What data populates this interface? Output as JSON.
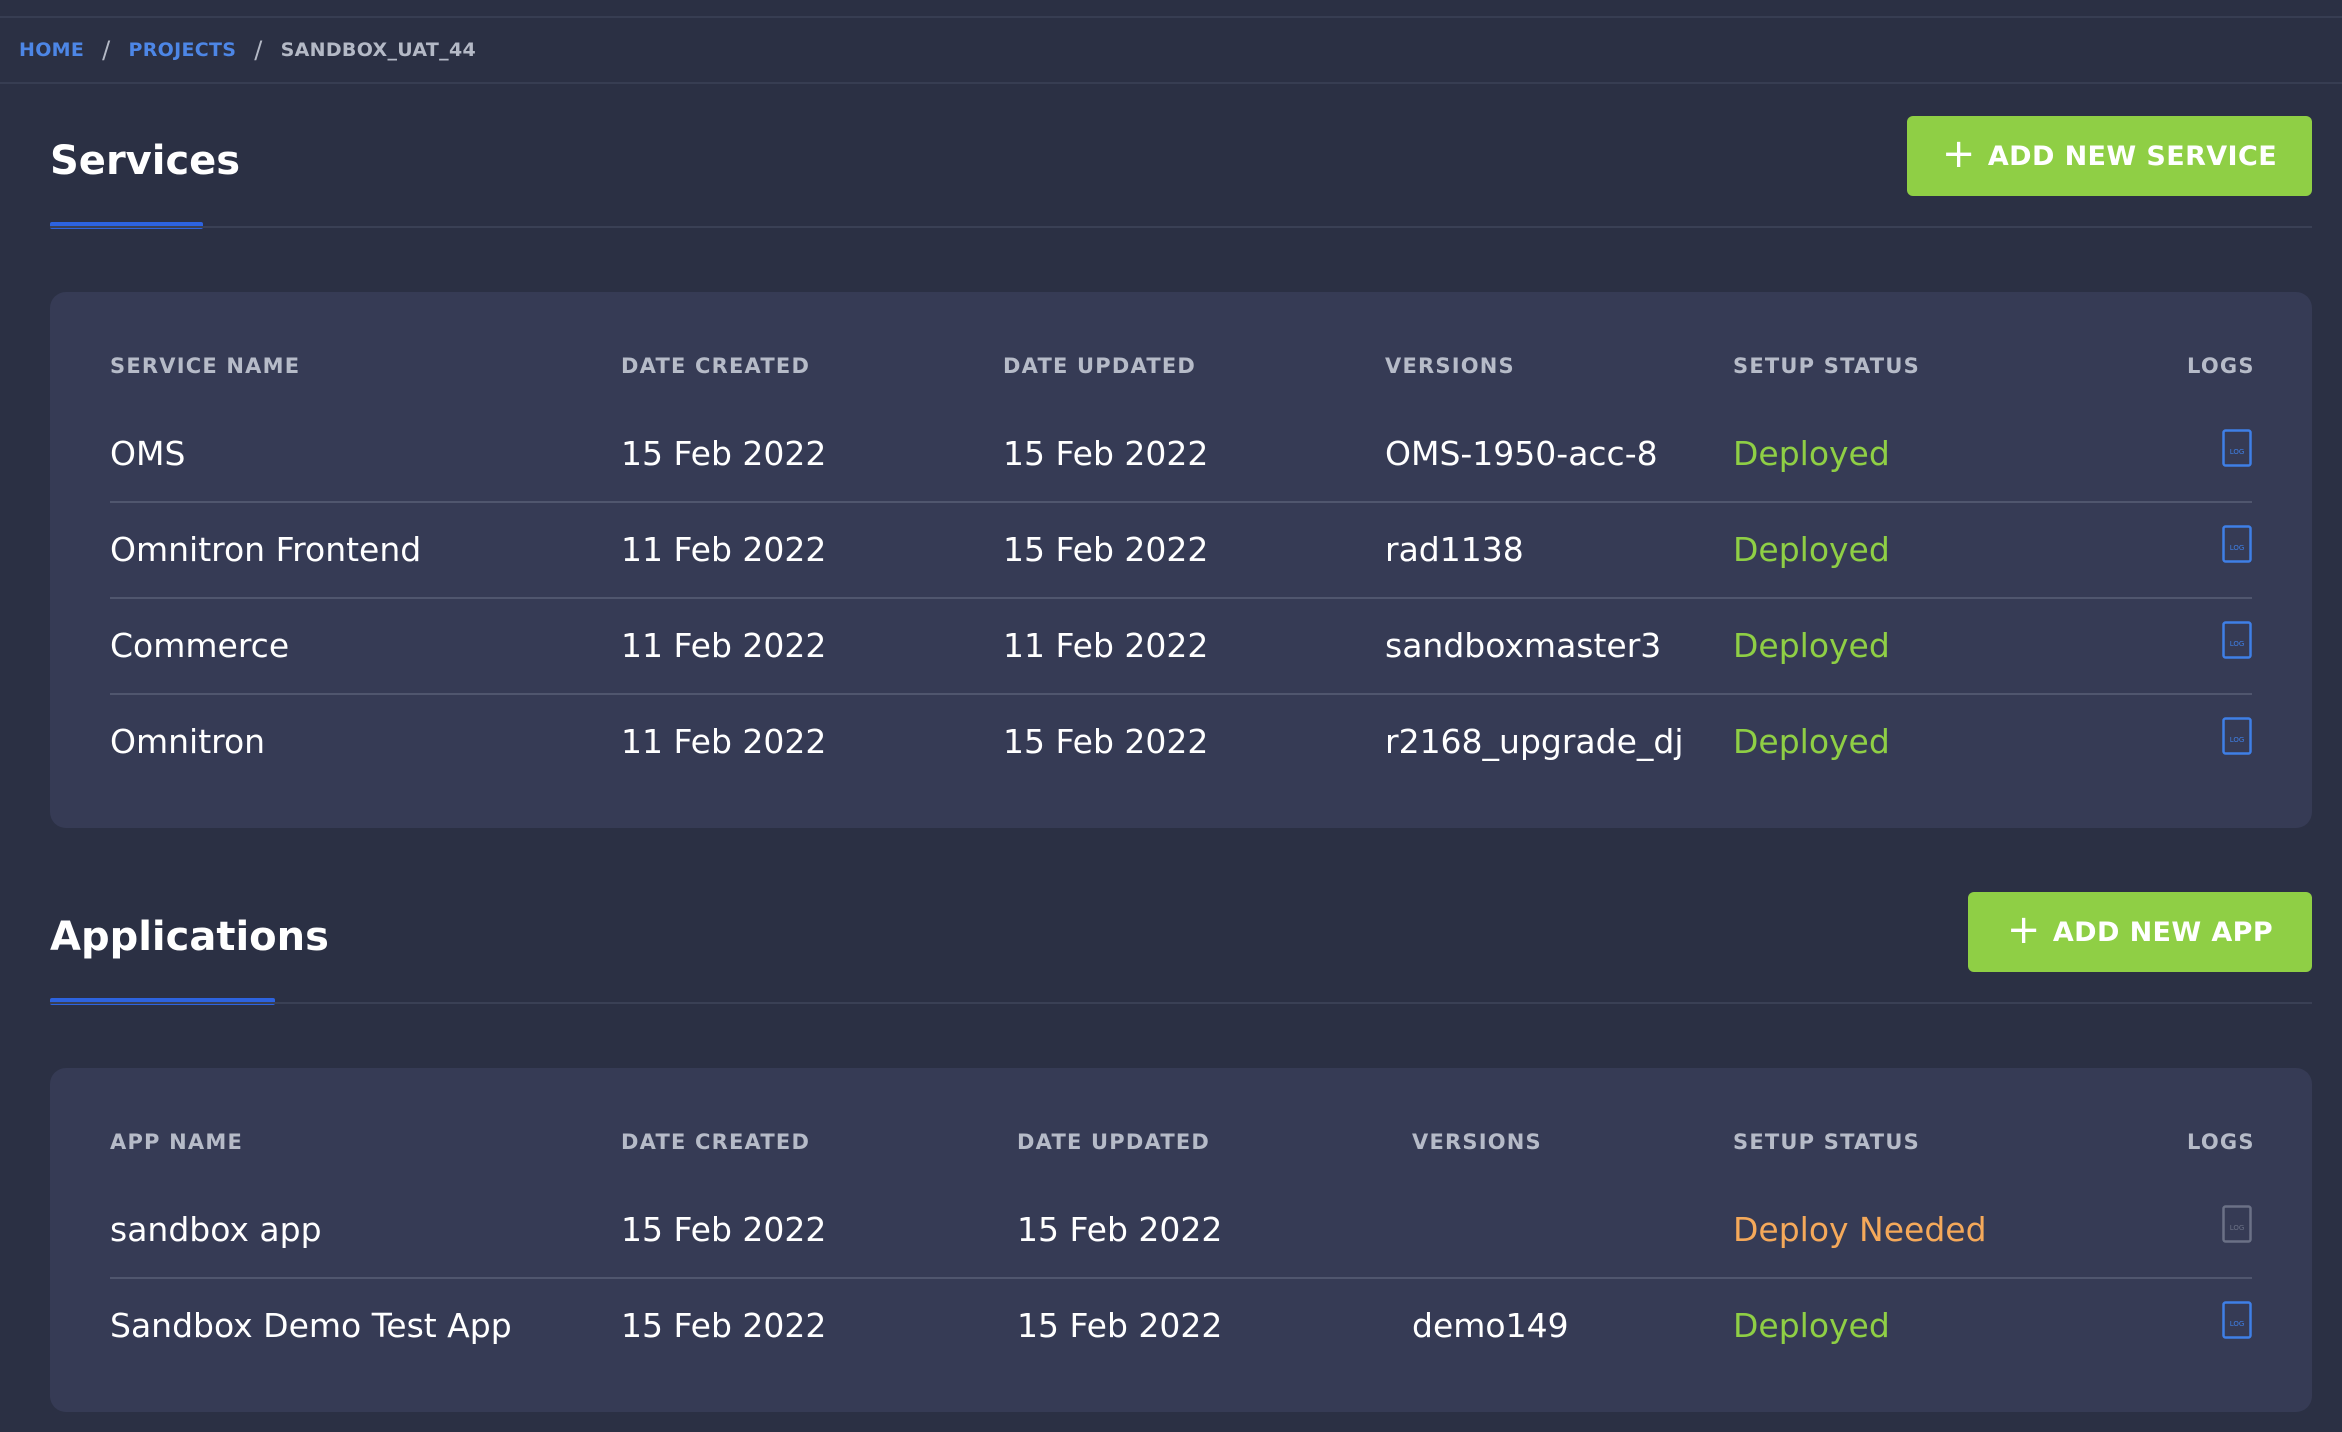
{
  "breadcrumb": {
    "home": "HOME",
    "projects": "PROJECTS",
    "current": "SANDBOX_UAT_44",
    "separator": "/"
  },
  "services": {
    "title": "Services",
    "add_button_label": "ADD NEW SERVICE",
    "columns": {
      "name": "SERVICE NAME",
      "date_created": "DATE CREATED",
      "date_updated": "DATE UPDATED",
      "versions": "VERSIONS",
      "setup_status": "SETUP STATUS",
      "logs": "LOGS"
    },
    "rows": [
      {
        "name": "OMS",
        "date_created": "15 Feb 2022",
        "date_updated": "15 Feb 2022",
        "version": "OMS-1950-acc-8",
        "status": "Deployed"
      },
      {
        "name": "Omnitron Frontend",
        "date_created": "11 Feb 2022",
        "date_updated": "15 Feb 2022",
        "version": "rad1138",
        "status": "Deployed"
      },
      {
        "name": "Commerce",
        "date_created": "11 Feb 2022",
        "date_updated": "11 Feb 2022",
        "version": "sandboxmaster3",
        "status": "Deployed"
      },
      {
        "name": "Omnitron",
        "date_created": "11 Feb 2022",
        "date_updated": "15 Feb 2022",
        "version": "r2168_upgrade_dj",
        "status": "Deployed"
      }
    ]
  },
  "applications": {
    "title": "Applications",
    "add_button_label": "ADD NEW APP",
    "columns": {
      "name": "APP NAME",
      "date_created": "DATE CREATED",
      "date_updated": "DATE UPDATED",
      "versions": "VERSIONS",
      "setup_status": "SETUP STATUS",
      "logs": "LOGS"
    },
    "rows": [
      {
        "name": "sandbox app",
        "date_created": "15 Feb 2022",
        "date_updated": "15 Feb 2022",
        "version": "",
        "status": "Deploy Needed"
      },
      {
        "name": "Sandbox Demo Test App",
        "date_created": "15 Feb 2022",
        "date_updated": "15 Feb 2022",
        "version": "demo149",
        "status": "Deployed"
      }
    ]
  },
  "log_icon_text": "LOG",
  "colors": {
    "background": "#2b3044",
    "card": "#363b55",
    "accent_blue": "#2d63df",
    "button_green": "#8fcf45",
    "status_deployed": "#8fcf45",
    "status_deploy_needed": "#f5a95a",
    "log_icon_active": "#3f7fe6",
    "log_icon_disabled": "#6b7186"
  }
}
